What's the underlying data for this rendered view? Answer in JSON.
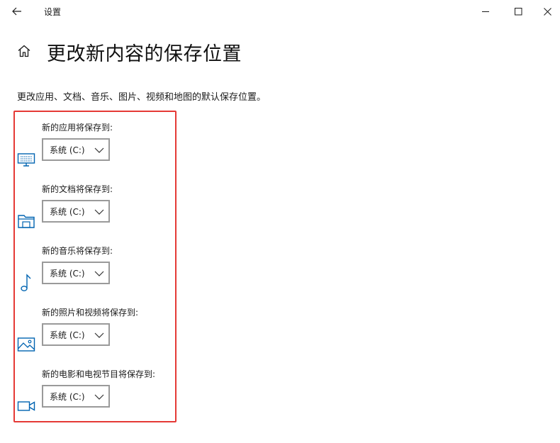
{
  "titlebar": {
    "back_icon": "back-arrow-icon",
    "title": "设置",
    "minimize_icon": "minimize-icon",
    "maximize_icon": "maximize-icon",
    "close_icon": "close-icon"
  },
  "header": {
    "home_icon": "home-icon",
    "page_title": "更改新内容的保存位置"
  },
  "description": "更改应用、文档、音乐、图片、视频和地图的默认保存位置。",
  "accent_color": "#0063b1",
  "highlight_color": "#e53935",
  "settings": [
    {
      "label": "新的应用将保存到:",
      "icon": "monitor-icon",
      "value": "系统 (C:)"
    },
    {
      "label": "新的文档将保存到:",
      "icon": "folder-icon",
      "value": "系统 (C:)"
    },
    {
      "label": "新的音乐将保存到:",
      "icon": "music-note-icon",
      "value": "系统 (C:)"
    },
    {
      "label": "新的照片和视频将保存到:",
      "icon": "picture-icon",
      "value": "系统 (C:)"
    },
    {
      "label": "新的电影和电视节目将保存到:",
      "icon": "video-camera-icon",
      "value": "系统 (C:)"
    }
  ]
}
